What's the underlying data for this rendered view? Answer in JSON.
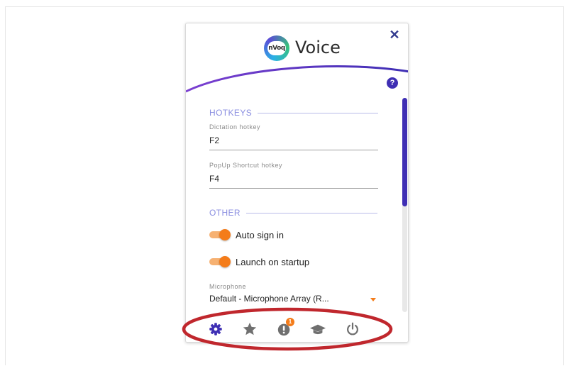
{
  "app": {
    "title": "Voice",
    "logo_text": "nVoq"
  },
  "header": {
    "close_icon": "close-icon",
    "help_icon": "help-icon"
  },
  "hotkeys": {
    "section_title": "HOTKEYS",
    "dictation": {
      "label": "Dictation hotkey",
      "value": "F2"
    },
    "popup": {
      "label": "PopUp Shortcut hotkey",
      "value": "F4"
    }
  },
  "other": {
    "section_title": "OTHER",
    "auto_sign_in": {
      "label": "Auto sign in",
      "enabled": true
    },
    "launch_on_startup": {
      "label": "Launch on startup",
      "enabled": true
    },
    "microphone": {
      "label": "Microphone",
      "value": "Default - Microphone Array (R..."
    }
  },
  "footer": {
    "items": [
      {
        "icon": "settings-gear-icon",
        "active": true
      },
      {
        "icon": "star-icon",
        "active": false
      },
      {
        "icon": "notifications-icon",
        "badge": "1",
        "active": false
      },
      {
        "icon": "graduation-cap-icon",
        "active": false
      },
      {
        "icon": "power-icon",
        "active": false
      }
    ]
  },
  "colors": {
    "accent": "#3f2fb4",
    "toggle": "#f47c1a",
    "annotation": "#c0272d",
    "inactive_icon": "#6f6f6f"
  }
}
